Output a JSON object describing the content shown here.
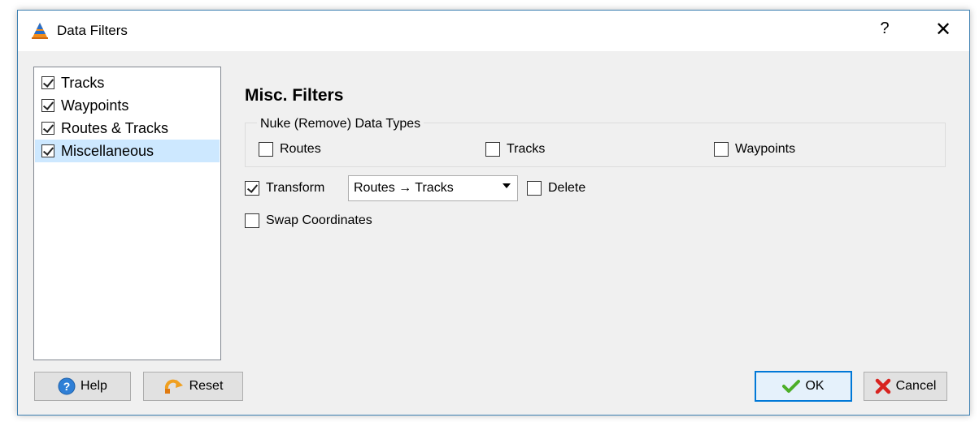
{
  "window": {
    "title": "Data Filters",
    "help_glyph": "?",
    "close_glyph": "✕",
    "icon": "gpsbabel-cone-icon"
  },
  "tree": {
    "items": [
      {
        "label": "Tracks",
        "checked": true
      },
      {
        "label": "Waypoints",
        "checked": true
      },
      {
        "label": "Routes & Tracks",
        "checked": true
      },
      {
        "label": "Miscellaneous",
        "checked": true,
        "selected": true
      }
    ]
  },
  "panel": {
    "title": "Misc. Filters",
    "nuke": {
      "title": "Nuke (Remove) Data Types",
      "routes": "Routes",
      "tracks": "Tracks",
      "waypoints": "Waypoints"
    },
    "transform_label": "Transform",
    "transform_value": "Routes → Tracks",
    "delete_label": "Delete",
    "swap_label": "Swap Coordinates"
  },
  "buttons": {
    "help": "Help",
    "reset": "Reset",
    "ok": "OK",
    "cancel": "Cancel"
  },
  "colors": {
    "accent": "#0078d7",
    "selection": "#cde8ff",
    "window_border": "#3c7fb1"
  }
}
